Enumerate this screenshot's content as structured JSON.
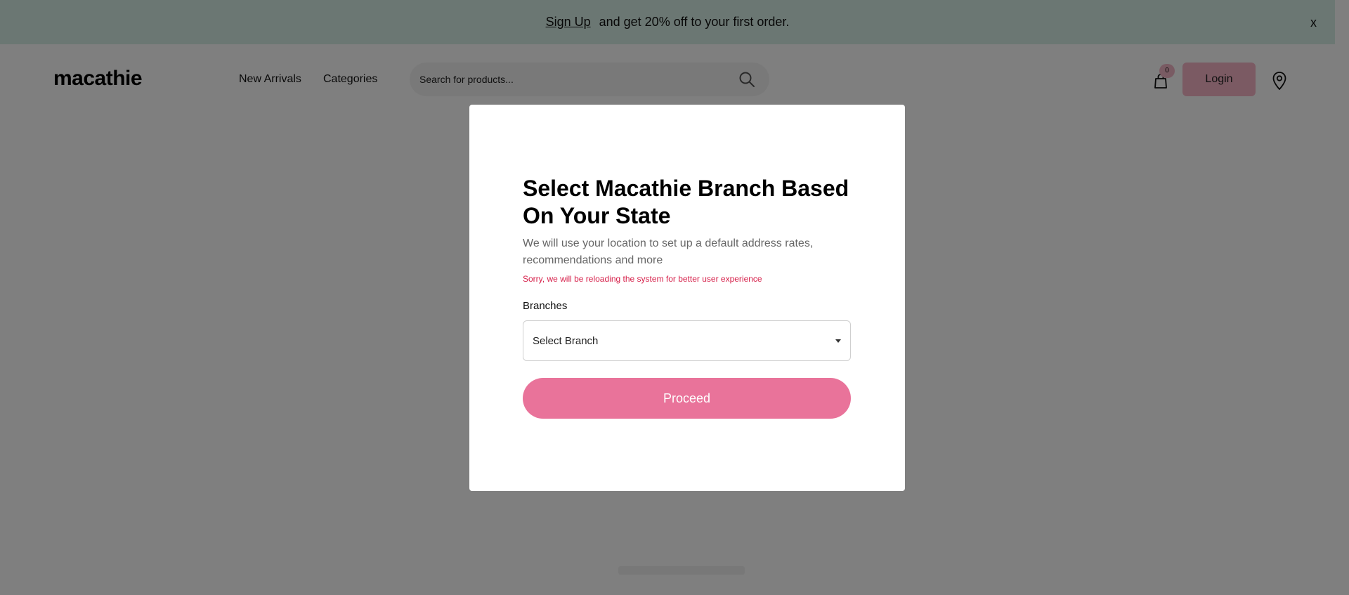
{
  "promo": {
    "signup_link": "Sign Up",
    "message": "and get 20% off to your first order.",
    "close_label": "x"
  },
  "header": {
    "logo": "macathie",
    "nav": [
      "New Arrivals",
      "Categories"
    ],
    "search_placeholder": "Search for products...",
    "cart_count": "0",
    "login_label": "Login"
  },
  "modal": {
    "title": "Select Macathie Branch Based On Your State",
    "description": "We will use your location to set up a default address rates, recommendations and more",
    "error": "Sorry, we will be reloading the system for better user experience",
    "branch_label": "Branches",
    "branch_select_value": "Select Branch",
    "proceed_label": "Proceed"
  },
  "icons": {
    "search": "search-icon",
    "cart": "shopping-bag-icon",
    "location": "location-pin-icon",
    "dropdown": "caret-down-icon"
  },
  "colors": {
    "promo_bg": "#d7efe6",
    "accent_pink": "#e9739a",
    "login_bg": "#f6b4c6",
    "error_red": "#d6204a"
  }
}
